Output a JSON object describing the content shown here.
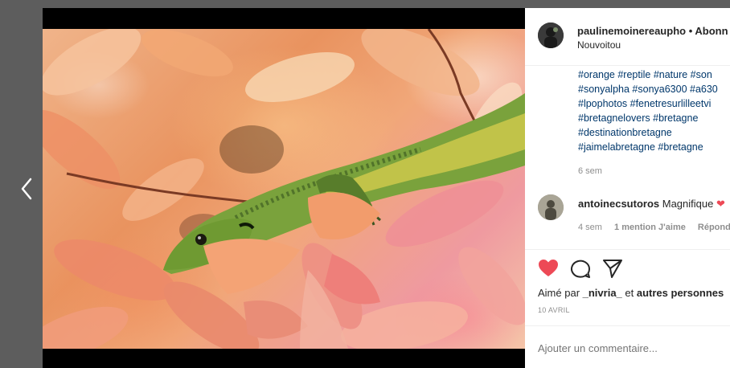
{
  "post": {
    "username": "paulinemoinereaupho",
    "separator": " • ",
    "follow_label": "Abonn",
    "location": "Nouvoitou"
  },
  "caption": {
    "hashtag_lines": [
      "#orange #reptile #nature #son",
      "#sonyalpha #sonya6300 #a630",
      "#lpophotos #fenetresurlilleetvi",
      "#bretagnelovers #bretagne",
      "#destinationbretagne",
      "#jaimelabretagne #bretagne"
    ],
    "time": "6 sem"
  },
  "comment": {
    "username": "antoinecsutoros",
    "text": "Magnifique",
    "emoji": "❤",
    "time": "4 sem",
    "likes": "1 mention J'aime",
    "reply": "Répond"
  },
  "engagement": {
    "liked_by_prefix": "Aimé par ",
    "liked_by_user": "_nivria_",
    "liked_by_mid": " et ",
    "liked_by_others": "autres personnes",
    "date": "10 AVRIL"
  },
  "add_comment": {
    "placeholder": "Ajouter un commentaire..."
  },
  "icons": {
    "prev": "chevron-left-icon",
    "like": "heart-filled-icon",
    "comment": "comment-bubble-icon",
    "share": "paper-plane-icon"
  },
  "colors": {
    "like_red": "#ed4956",
    "hashtag_blue": "#00376b",
    "overlay": "#5d5d5d"
  }
}
